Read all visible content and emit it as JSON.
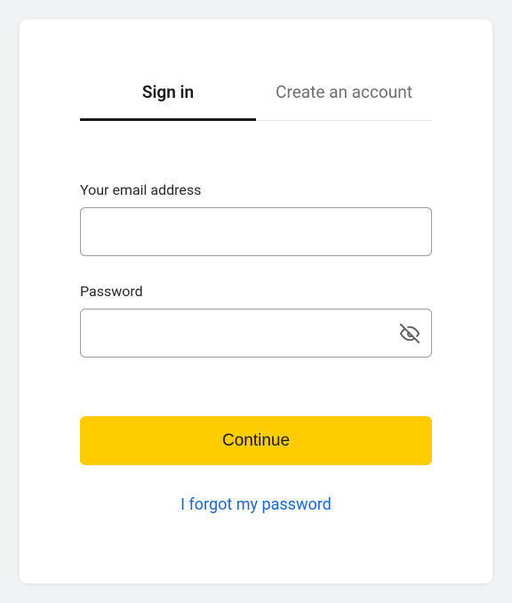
{
  "tabs": {
    "signin": "Sign in",
    "create": "Create an account"
  },
  "form": {
    "email_label": "Your email address",
    "email_value": "",
    "password_label": "Password",
    "password_value": ""
  },
  "actions": {
    "continue": "Continue",
    "forgot": "I forgot my password"
  },
  "colors": {
    "accent": "#ffcc00",
    "link": "#1a66d6"
  }
}
